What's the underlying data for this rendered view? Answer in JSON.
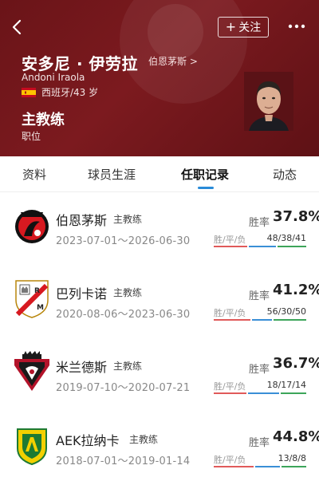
{
  "header": {
    "name_cn": "安多尼 · 伊劳拉",
    "name_en": "Andoni Iraola",
    "team_link": "伯恩茅斯 >",
    "nationality_age": "西班牙/43 岁",
    "position": "主教练",
    "position_label": "职位",
    "follow_label": "关注",
    "follow_plus": "+",
    "back_icon": "chevron-left-icon",
    "more_icon": "more-dots-icon",
    "flag_icon": "spain-flag-icon",
    "avatar": "coach-avatar",
    "bg_color": "#6e161b"
  },
  "tabs": [
    "资料",
    "球员生涯",
    "任职记录",
    "动态"
  ],
  "active_tab": "任职记录",
  "accent_color": "#2a8bd8",
  "records": [
    {
      "club": "伯恩茅斯",
      "role": "主教练",
      "dates": "2023-07-01～2026-06-30",
      "win_rate_label": "胜率",
      "win_rate": "37.8%",
      "wdl_label": "胜/平/负",
      "wdl": "48/38/41",
      "logo": "bournemouth-logo"
    },
    {
      "club": "巴列卡诺",
      "role": "主教练",
      "dates": "2020-08-06～2023-06-30",
      "win_rate_label": "胜率",
      "win_rate": "41.2%",
      "wdl_label": "胜/平/负",
      "wdl": "56/30/50",
      "logo": "rayo-vallecano-logo"
    },
    {
      "club": "米兰德斯",
      "role": "主教练",
      "dates": "2019-07-10～2020-07-21",
      "win_rate_label": "胜率",
      "win_rate": "36.7%",
      "wdl_label": "胜/平/负",
      "wdl": "18/17/14",
      "logo": "mirandes-logo"
    },
    {
      "club": "AEK拉纳卡",
      "role": "主教练",
      "dates": "2018-07-01～2019-01-14",
      "win_rate_label": "胜率",
      "win_rate": "44.8%",
      "wdl_label": "胜/平/负",
      "wdl": "13/8/8",
      "logo": "aek-larnaca-logo"
    }
  ]
}
